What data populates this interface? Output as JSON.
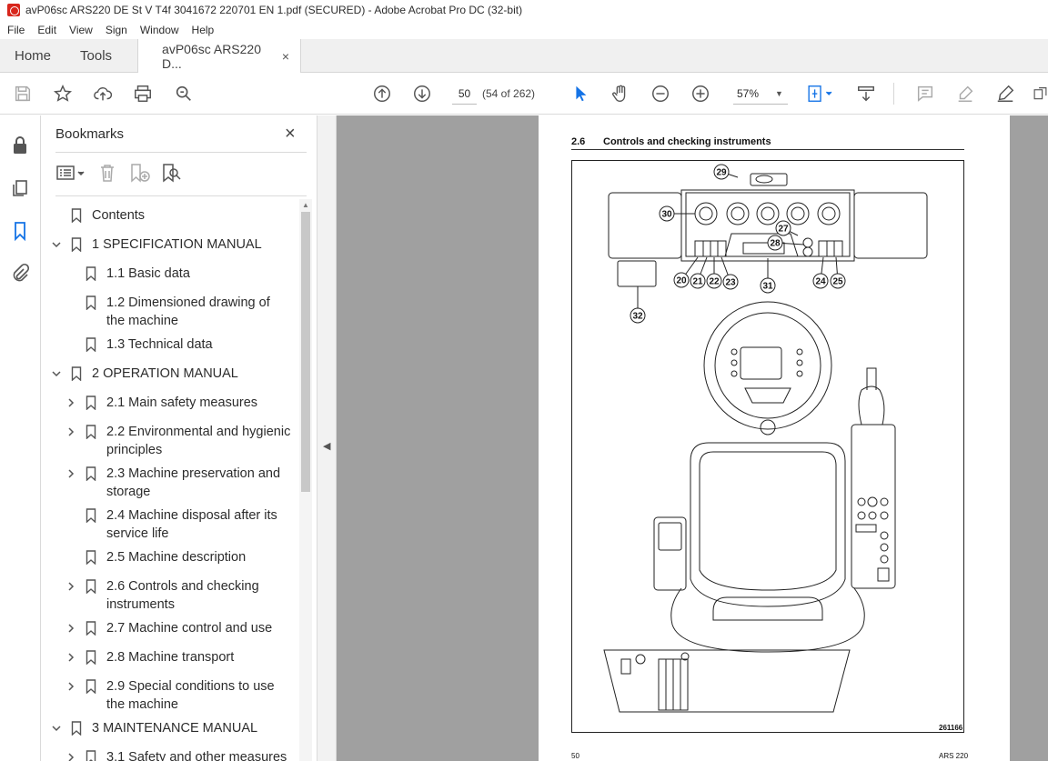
{
  "window": {
    "title": "avP06sc ARS220 DE St V T4f 3041672 220701 EN 1.pdf (SECURED) - Adobe Acrobat Pro DC (32-bit)"
  },
  "menu": [
    "File",
    "Edit",
    "View",
    "Sign",
    "Window",
    "Help"
  ],
  "tabs": {
    "home": "Home",
    "tools": "Tools",
    "document": "avP06sc ARS220 D...",
    "close": "×"
  },
  "toolbar": {
    "page_number": "50",
    "page_count": "(54 of 262)",
    "zoom": "57%",
    "icons": [
      "save-icon",
      "star-icon",
      "upload-icon",
      "print-icon",
      "search-icon",
      "page-up-icon",
      "page-down-icon",
      "select-arrow-icon",
      "hand-icon",
      "zoom-out-icon",
      "zoom-in-icon",
      "fit-page-icon",
      "scroll-mode-icon",
      "comment-icon",
      "highlight-icon",
      "sign-icon",
      "more-tools-icon"
    ]
  },
  "rail": {
    "icons": [
      "lock-icon",
      "pages-icon",
      "bookmarks-icon",
      "attachment-icon"
    ]
  },
  "bookmarks": {
    "title": "Bookmarks",
    "close": "×",
    "items": [
      {
        "label": "Contents",
        "level": 0,
        "expand": "none"
      },
      {
        "label": "1 SPECIFICATION MANUAL",
        "level": 0,
        "expand": "open"
      },
      {
        "label": "1.1 Basic data",
        "level": 1,
        "expand": "none"
      },
      {
        "label": "1.2 Dimensioned drawing of",
        "label2": "the machine",
        "level": 1,
        "expand": "none"
      },
      {
        "label": "1.3 Technical data",
        "level": 1,
        "expand": "none"
      },
      {
        "label": "2 OPERATION MANUAL",
        "level": 0,
        "expand": "open"
      },
      {
        "label": "2.1 Main safety measures",
        "level": 1,
        "expand": "closed"
      },
      {
        "label": "2.2 Environmental and hygienic",
        "label2": "principles",
        "level": 1,
        "expand": "closed"
      },
      {
        "label": "2.3 Machine preservation and",
        "label2": "storage",
        "level": 1,
        "expand": "closed"
      },
      {
        "label": "2.4 Machine disposal after its",
        "label2": "service life",
        "level": 1,
        "expand": "none"
      },
      {
        "label": "2.5 Machine description",
        "level": 1,
        "expand": "none"
      },
      {
        "label": "2.6 Controls and checking",
        "label2": "instruments",
        "level": 1,
        "expand": "closed"
      },
      {
        "label": "2.7 Machine control and use",
        "level": 1,
        "expand": "closed"
      },
      {
        "label": "2.8 Machine transport",
        "level": 1,
        "expand": "closed"
      },
      {
        "label": "2.9 Special conditions to use",
        "label2": "the machine",
        "level": 1,
        "expand": "closed"
      },
      {
        "label": "3 MAINTENANCE MANUAL",
        "level": 0,
        "expand": "open"
      },
      {
        "label": "3.1 Safety and other measures",
        "level": 1,
        "expand": "closed"
      }
    ]
  },
  "document": {
    "section_number": "2.6",
    "section_title": "Controls and checking instruments",
    "figure_id": "261166",
    "footer_left": "50",
    "footer_right": "ARS 220",
    "callouts": [
      "29",
      "30",
      "27",
      "28",
      "20",
      "21",
      "22",
      "23",
      "31",
      "24",
      "25",
      "32"
    ]
  }
}
